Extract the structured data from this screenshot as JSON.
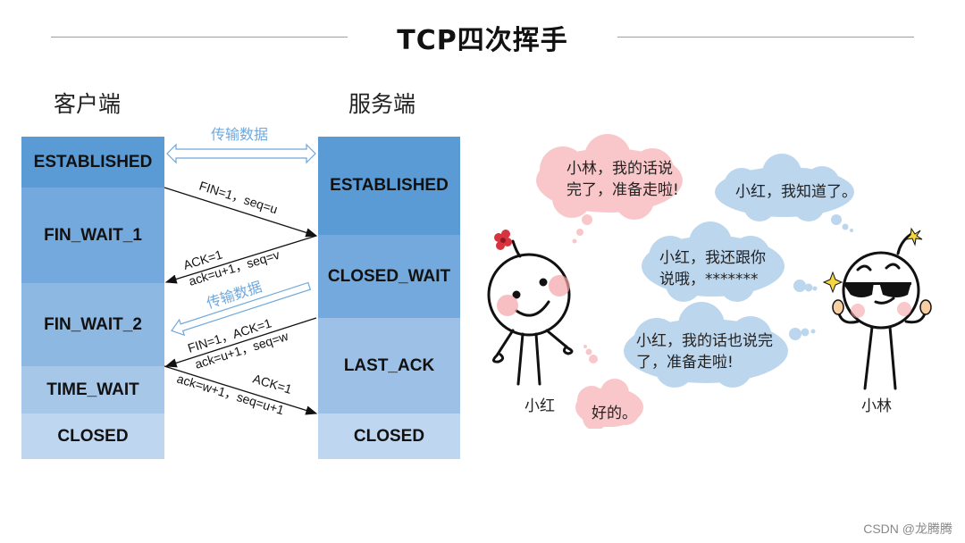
{
  "title": "TCP四次挥手",
  "client_label": "客户端",
  "server_label": "服务端",
  "colors": {
    "rule": "#7ea6d3",
    "state_dark": "#5b9bd5",
    "state_mid": "#74a9dd",
    "state_light1": "#8db8e2",
    "state_light2": "#a7c7e9",
    "state_light3": "#bed6ef",
    "data_arrow": "#6fa8dc",
    "pink_bubble": "#f9c7c9",
    "blue_bubble": "#bcd6ee"
  },
  "client_states": [
    "ESTABLISHED",
    "FIN_WAIT_1",
    "FIN_WAIT_2",
    "TIME_WAIT",
    "CLOSED"
  ],
  "server_states": [
    "ESTABLISHED",
    "CLOSED_WAIT",
    "LAST_ACK",
    "CLOSED"
  ],
  "data_transfer_label": "传输数据",
  "data_transfer_label_2": "传输数据",
  "messages": {
    "m1": "FIN=1，seq=u",
    "m2a": "ACK=1",
    "m2b": "ack=u+1，seq=v",
    "m3a": "FIN=1，ACK=1",
    "m3b": "ack=u+1，seq=w",
    "m4a": "ACK=1",
    "m4b": "ack=w+1，seq=u+1"
  },
  "comic": {
    "bubble1": [
      "小林，我的话说",
      "完了，准备走啦!"
    ],
    "bubble2": [
      "小红，我知道了。"
    ],
    "bubble3": [
      "小红，我还跟你",
      "说哦，*******"
    ],
    "bubble4": [
      "小红，我的话也说完",
      "了，准备走啦!"
    ],
    "bubble5": [
      "好的。"
    ],
    "character_left": "小红",
    "character_right": "小林"
  },
  "watermark": "CSDN @龙腾腾"
}
